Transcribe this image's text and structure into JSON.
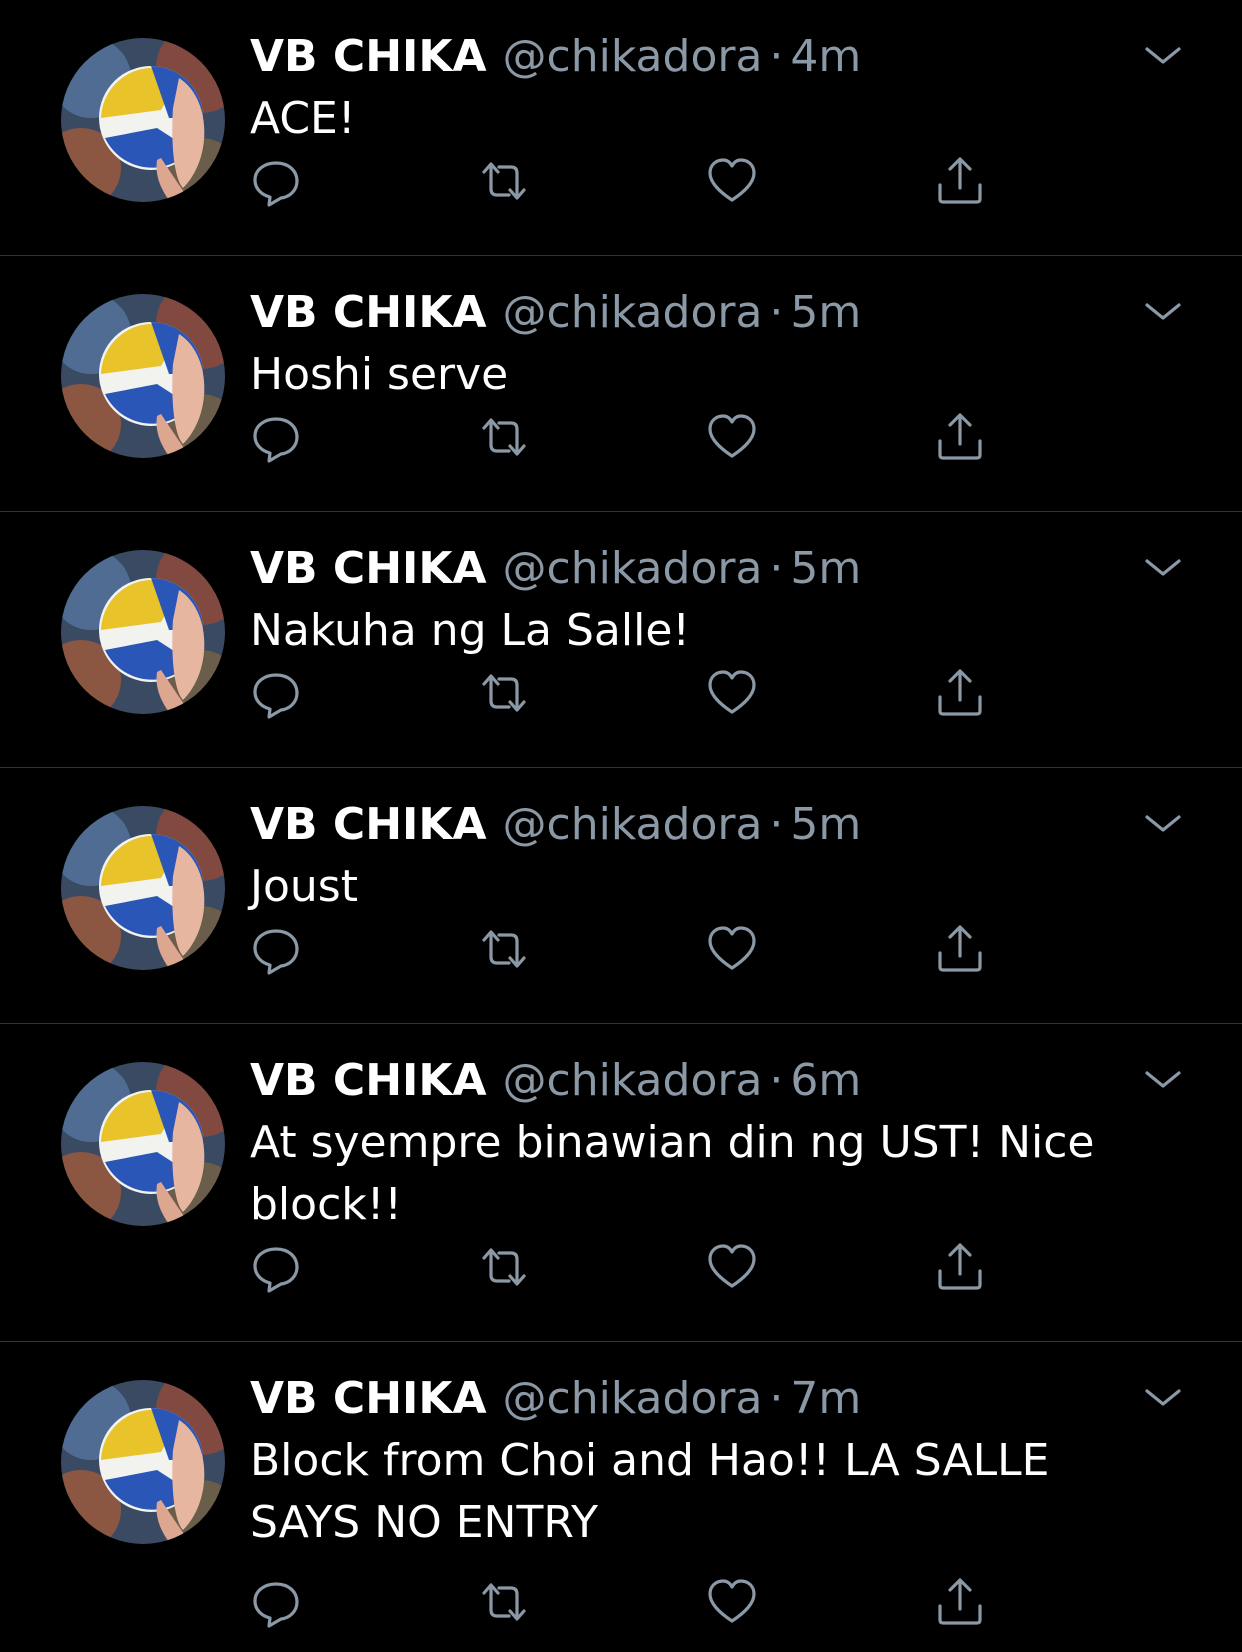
{
  "accent_color": "#8b98a5",
  "background_color": "#000000",
  "tweets": [
    {
      "name": "VB CHIKA",
      "handle": "@chikadora",
      "dot": "·",
      "time": "4m",
      "text": "ACE!"
    },
    {
      "name": "VB CHIKA",
      "handle": "@chikadora",
      "dot": "·",
      "time": "5m",
      "text": "Hoshi serve"
    },
    {
      "name": "VB CHIKA",
      "handle": "@chikadora",
      "dot": "·",
      "time": "5m",
      "text": "Nakuha ng La Salle!"
    },
    {
      "name": "VB CHIKA",
      "handle": "@chikadora",
      "dot": "·",
      "time": "5m",
      "text": "Joust"
    },
    {
      "name": "VB CHIKA",
      "handle": "@chikadora",
      "dot": "·",
      "time": "6m",
      "text": "At syempre binawian din ng UST! Nice block!!"
    },
    {
      "name": "VB CHIKA",
      "handle": "@chikadora",
      "dot": "·",
      "time": "7m",
      "text": "Block from Choi and Hao!! LA SALLE SAYS NO ENTRY"
    }
  ],
  "icons": {
    "reply": "reply-icon",
    "retweet": "retweet-icon",
    "like": "heart-icon",
    "share": "share-icon",
    "more": "chevron-down-icon",
    "avatar": "volleyball-avatar"
  }
}
